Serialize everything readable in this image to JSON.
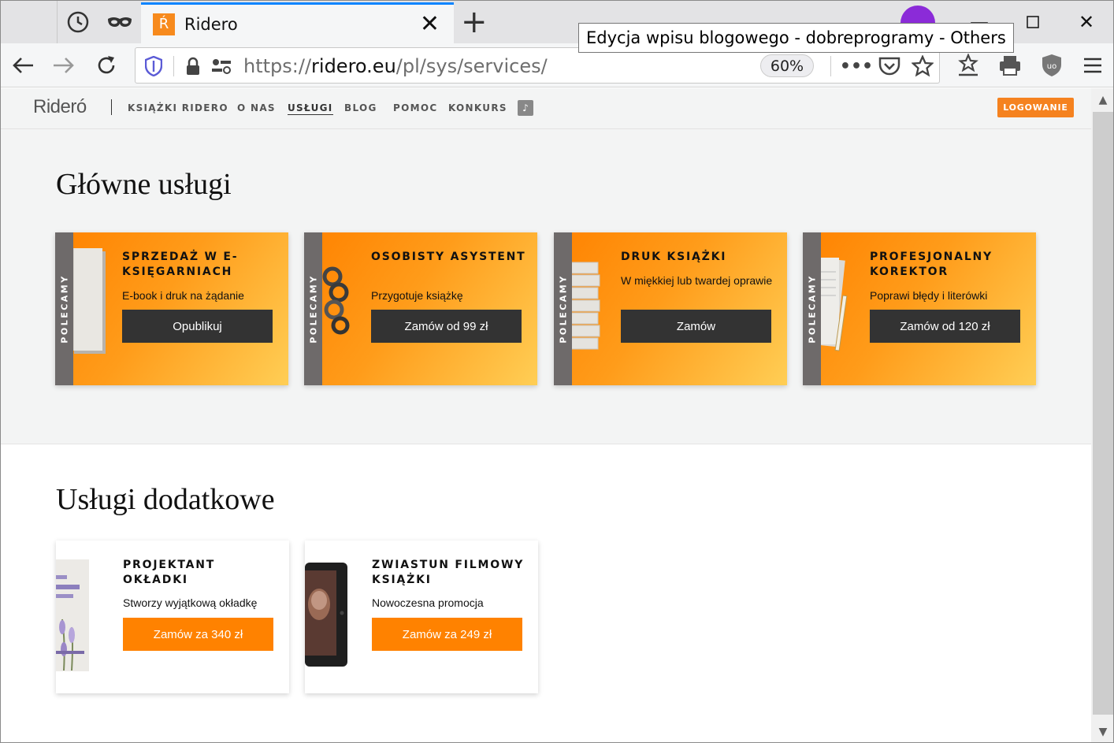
{
  "browser": {
    "tab_title": "Ridero",
    "tab_favicon": "Ŕ",
    "tooltip": "Edycja wpisu blogowego - dobreprogramy - Others",
    "url_prefix": "https://",
    "url_domain": "ridero.eu",
    "url_path": "/pl/sys/services/",
    "zoom": "60%",
    "icons": [
      "history-icon",
      "private-mask-icon",
      "close-icon",
      "new-tab-icon",
      "account-icon",
      "minimize-icon",
      "maximize-icon",
      "window-close-icon",
      "back-icon",
      "forward-icon",
      "reload-icon",
      "shield-icon",
      "lock-icon",
      "permissions-icon",
      "more-icon",
      "pocket-icon",
      "bookmark-star-icon",
      "bookmarks-icon",
      "print-icon",
      "ublock-icon",
      "menu-icon"
    ]
  },
  "site": {
    "logo": "Rideró",
    "menu": [
      "KSIĄŻKI RIDERO",
      "O NAS",
      "USŁUGI",
      "BLOG",
      "POMOC",
      "KONKURS"
    ],
    "active_menu": "USŁUGI",
    "login": "LOGOWANIE",
    "accent_color": "#ff8200"
  },
  "main_services": {
    "title": "Główne usługi",
    "ribbon": "POLECAMY",
    "cards": [
      {
        "title": "SPRZEDAŻ W E-KSIĘGARNIACH",
        "desc": "E-book i druk na żądanie",
        "button": "Opublikuj"
      },
      {
        "title": "OSOBISTY ASYSTENT",
        "desc": "Przygotuje książkę",
        "button": "Zamów od 99 zł"
      },
      {
        "title": "DRUK KSIĄŻKI",
        "desc": "W miękkiej lub twardej oprawie",
        "button": "Zamów"
      },
      {
        "title": "PROFESJONALNY KOREKTOR",
        "desc": "Poprawi błędy i literówki",
        "button": "Zamów od 120 zł"
      }
    ]
  },
  "additional_services": {
    "title": "Usługi dodatkowe",
    "cards": [
      {
        "title": "PROJEKTANT OKŁADKI",
        "desc": "Stworzy wyjątkową okładkę",
        "button": "Zamów za 340 zł"
      },
      {
        "title": "ZWIASTUN FILMOWY KSIĄŻKI",
        "desc": "Nowoczesna promocja",
        "button": "Zamów za 249 zł"
      }
    ]
  }
}
